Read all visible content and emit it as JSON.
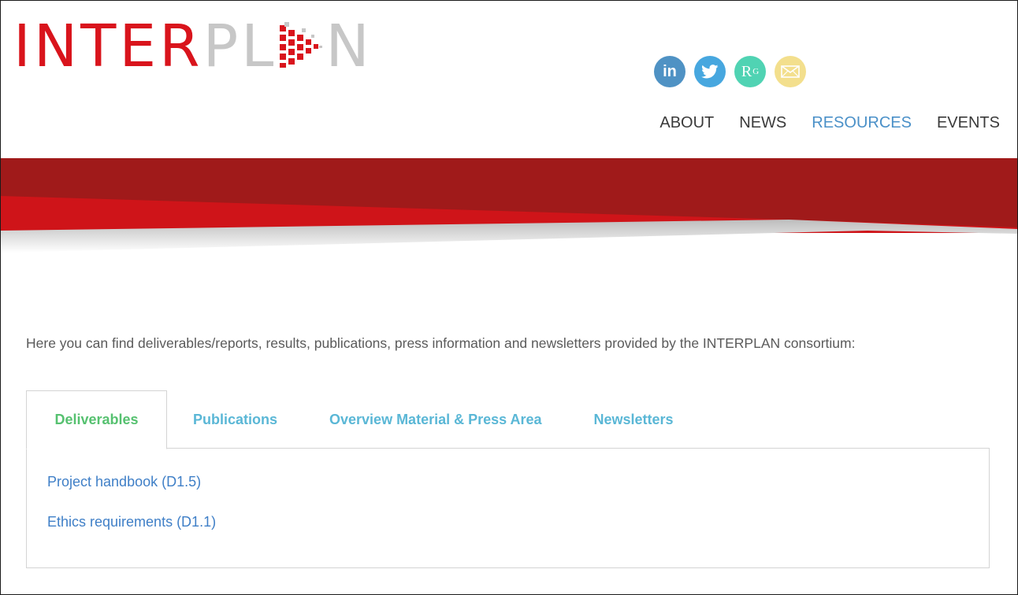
{
  "logo": {
    "part_red": "INTER",
    "part_gray_a": "PL",
    "part_gray_b": "N",
    "mark_icon": "arrow-mosaic-icon",
    "colors": {
      "red": "#d9141c",
      "gray": "#c7c7c7"
    }
  },
  "social": [
    {
      "name": "linkedin",
      "glyph": "in",
      "color": "#4f92c4"
    },
    {
      "name": "twitter",
      "icon": "twitter-bird-icon",
      "color": "#47a7df"
    },
    {
      "name": "researchgate",
      "glyph": "R",
      "sup": "G",
      "color": "#50d3b3"
    },
    {
      "name": "email",
      "icon": "envelope-icon",
      "color": "#f3df8d"
    }
  ],
  "nav": {
    "items": [
      {
        "label": "ABOUT"
      },
      {
        "label": "NEWS"
      },
      {
        "label": "RESOURCES",
        "active": true
      },
      {
        "label": "EVENTS"
      }
    ],
    "active_color": "#4a90c8"
  },
  "banner": {
    "dark_red": "#a01a1a",
    "red": "#cf1419",
    "shadow": "#c8c8c8"
  },
  "intro": "Here you can find deliverables/reports, results, publications, press information and newsletters provided by the INTERPLAN consortium:",
  "tabs": [
    {
      "label": "Deliverables",
      "active": true
    },
    {
      "label": "Publications"
    },
    {
      "label": "Overview Material & Press Area"
    },
    {
      "label": "Newsletters"
    }
  ],
  "deliverables": [
    {
      "label": "Project handbook (D1.5)"
    },
    {
      "label": "Ethics requirements (D1.1)"
    }
  ]
}
